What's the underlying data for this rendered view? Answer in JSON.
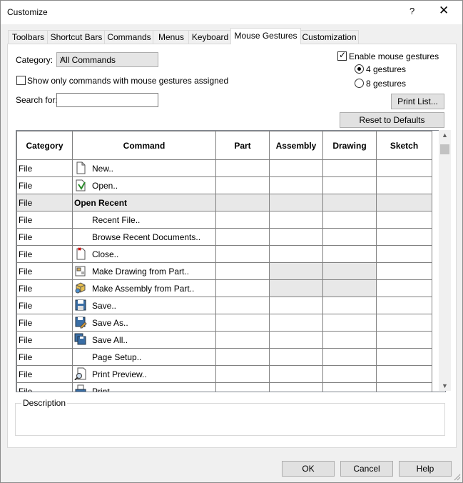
{
  "window": {
    "title": "Customize",
    "help": "?",
    "close": "✕"
  },
  "tabs": [
    {
      "label": "Toolbars"
    },
    {
      "label": "Shortcut Bars"
    },
    {
      "label": "Commands"
    },
    {
      "label": "Menus"
    },
    {
      "label": "Keyboard"
    },
    {
      "label": "Mouse Gestures"
    },
    {
      "label": "Customization"
    }
  ],
  "active_tab": "Mouse Gestures",
  "filters": {
    "category_label": "Category:",
    "category_value": "All Commands",
    "show_only_label": "Show only commands with mouse gestures assigned",
    "show_only_checked": false,
    "search_label": "Search for:",
    "search_value": ""
  },
  "gestures": {
    "enable_label": "Enable mouse gestures",
    "enable_checked": true,
    "option4": "4 gestures",
    "option8": "8 gestures",
    "selected": "4 gestures"
  },
  "buttons": {
    "print_list": "Print List...",
    "reset": "Reset to Defaults",
    "ok": "OK",
    "cancel": "Cancel",
    "help": "Help"
  },
  "table": {
    "headers": [
      "Category",
      "Command",
      "Part",
      "Assembly",
      "Drawing",
      "Sketch"
    ],
    "rows": [
      {
        "category": "File",
        "command": "New..",
        "icon": "new-document-icon"
      },
      {
        "category": "File",
        "command": "Open..",
        "icon": "open-document-icon"
      },
      {
        "category": "File",
        "command": "Open Recent",
        "icon": "",
        "group": true
      },
      {
        "category": "File",
        "command": "Recent File..",
        "icon": ""
      },
      {
        "category": "File",
        "command": "Browse Recent Documents..",
        "icon": ""
      },
      {
        "category": "File",
        "command": "Close..",
        "icon": "close-document-icon"
      },
      {
        "category": "File",
        "command": "Make Drawing from Part..",
        "icon": "make-drawing-icon",
        "disabled": [
          "Assembly",
          "Drawing"
        ]
      },
      {
        "category": "File",
        "command": "Make Assembly from Part..",
        "icon": "make-assembly-icon",
        "disabled": [
          "Assembly",
          "Drawing"
        ]
      },
      {
        "category": "File",
        "command": "Save..",
        "icon": "save-icon"
      },
      {
        "category": "File",
        "command": "Save As..",
        "icon": "save-as-icon"
      },
      {
        "category": "File",
        "command": "Save All..",
        "icon": "save-all-icon"
      },
      {
        "category": "File",
        "command": "Page Setup..",
        "icon": ""
      },
      {
        "category": "File",
        "command": "Print Preview..",
        "icon": "print-preview-icon"
      },
      {
        "category": "File",
        "command": "Print..",
        "icon": "print-icon"
      }
    ]
  },
  "description": {
    "label": "Description"
  }
}
